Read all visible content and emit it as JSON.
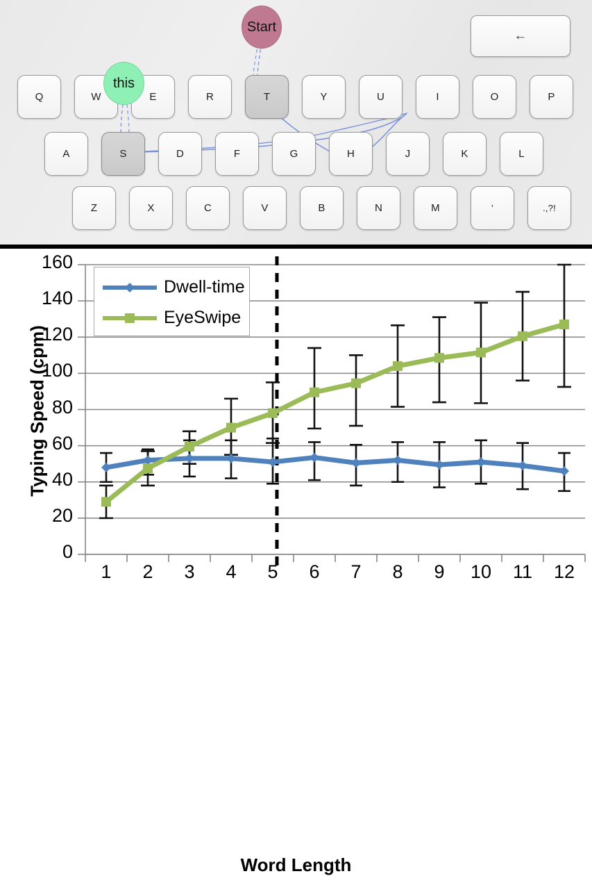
{
  "keyboard": {
    "rows": [
      {
        "name": "row-top",
        "keys": [
          "Q",
          "W",
          "E",
          "R",
          "T",
          "Y",
          "U",
          "I",
          "O",
          "P"
        ]
      },
      {
        "name": "row-home",
        "keys": [
          "A",
          "S",
          "D",
          "F",
          "G",
          "H",
          "J",
          "K",
          "L"
        ]
      },
      {
        "name": "row-bottom",
        "keys": [
          "Z",
          "X",
          "C",
          "V",
          "B",
          "N",
          "M",
          "'",
          ".,?!"
        ]
      }
    ],
    "highlighted_keys": [
      "T",
      "S"
    ],
    "backspace_label": "←",
    "bubbles": [
      {
        "name": "start-bubble",
        "label": "Start",
        "color": "#bf7a92"
      },
      {
        "name": "word-bubble",
        "label": "this",
        "color": "#8ef0b4"
      }
    ],
    "gaze_trace_color": "#7a93e0",
    "panel_background": "#eaeaea"
  },
  "chart_data": {
    "type": "line",
    "title": "",
    "xlabel": "Word Length",
    "ylabel": "Typing Speed (cpm)",
    "categories": [
      1,
      2,
      3,
      4,
      5,
      6,
      7,
      8,
      9,
      10,
      11,
      12
    ],
    "xtick_labels": [
      "1",
      "2",
      "3",
      "4",
      "5",
      "6",
      "7",
      "8",
      "9",
      "10",
      "11",
      "12"
    ],
    "ytick_labels": [
      "0",
      "20",
      "40",
      "60",
      "80",
      "100",
      "120",
      "140",
      "160"
    ],
    "ylim": [
      0,
      160
    ],
    "ytick_step": 20,
    "grid": true,
    "legend_position": "top-left",
    "annotations": [
      {
        "name": "threshold-line",
        "type": "vertical-dashed-line",
        "x": 4.6,
        "color": "#000000"
      }
    ],
    "series": [
      {
        "name": "Dwell-time",
        "color": "#4F81BD",
        "marker": "diamond",
        "values": [
          48,
          52,
          53,
          53,
          51,
          53.5,
          50.5,
          52,
          49.5,
          51,
          49,
          46
        ],
        "err_upper": [
          56,
          58,
          63,
          63,
          64,
          62,
          60.5,
          62,
          62,
          63,
          61.5,
          56
        ],
        "err_lower": [
          40,
          44,
          43,
          42,
          39,
          41,
          38,
          40,
          37,
          39,
          36,
          35
        ]
      },
      {
        "name": "EyeSwipe",
        "color": "#9BBB59",
        "marker": "square",
        "values": [
          29,
          47.5,
          59.5,
          70,
          78,
          89.5,
          94.5,
          104,
          108.5,
          111.5,
          120.5,
          127
        ],
        "err_upper": [
          38,
          57,
          68,
          86,
          95,
          114,
          110,
          126.5,
          131,
          139,
          145,
          160
        ],
        "err_lower": [
          20,
          38,
          50,
          55,
          61.5,
          69.5,
          71,
          81.5,
          84,
          83.5,
          96,
          92.5
        ]
      }
    ]
  }
}
